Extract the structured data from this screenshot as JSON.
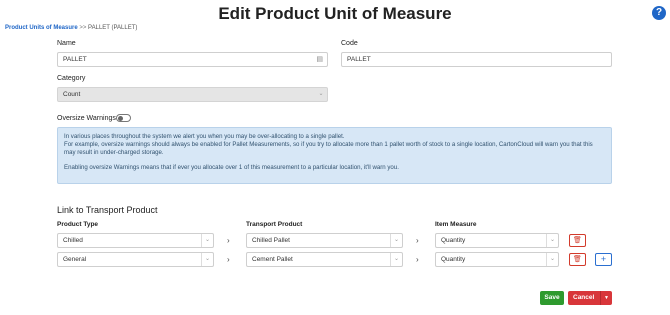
{
  "page": {
    "title": "Edit Product Unit of Measure",
    "help_icon": "?"
  },
  "breadcrumb": {
    "link": "Product Units of Measure",
    "separator": ">>",
    "current": "PALLET (PALLET)"
  },
  "form": {
    "name_label": "Name",
    "name_value": "PALLET",
    "code_label": "Code",
    "code_value": "PALLET",
    "category_label": "Category",
    "category_value": "Count",
    "oversize_label": "Oversize Warnings",
    "oversize_enabled": false
  },
  "info": {
    "line1": "In various places throughout the system we alert you when you may be over-allocating to a single pallet.",
    "line2": "For example, oversize warnings should always be enabled for Pallet Measurements, so if you try to allocate more than 1 pallet worth of stock to a single location, CartonCloud will warn you that this may result in under-charged storage.",
    "line3": "Enabling oversize Warnings means that if ever you allocate over 1 of this measurement to a particular location, it'll warn you."
  },
  "transport": {
    "section_title": "Link to Transport Product",
    "col_product_type": "Product Type",
    "col_transport_product": "Transport Product",
    "col_item_measure": "Item Measure",
    "rows": [
      {
        "product_type": "Chilled",
        "transport_product": "Chilled Pallet",
        "item_measure": "Quantity"
      },
      {
        "product_type": "General",
        "transport_product": "Cement Pallet",
        "item_measure": "Quantity"
      }
    ]
  },
  "actions": {
    "save": "Save",
    "cancel": "Cancel"
  },
  "colors": {
    "accent": "#1f66c7",
    "save": "#2e9a2e",
    "cancel": "#d8363a",
    "info_bg": "#d7e7f6"
  }
}
